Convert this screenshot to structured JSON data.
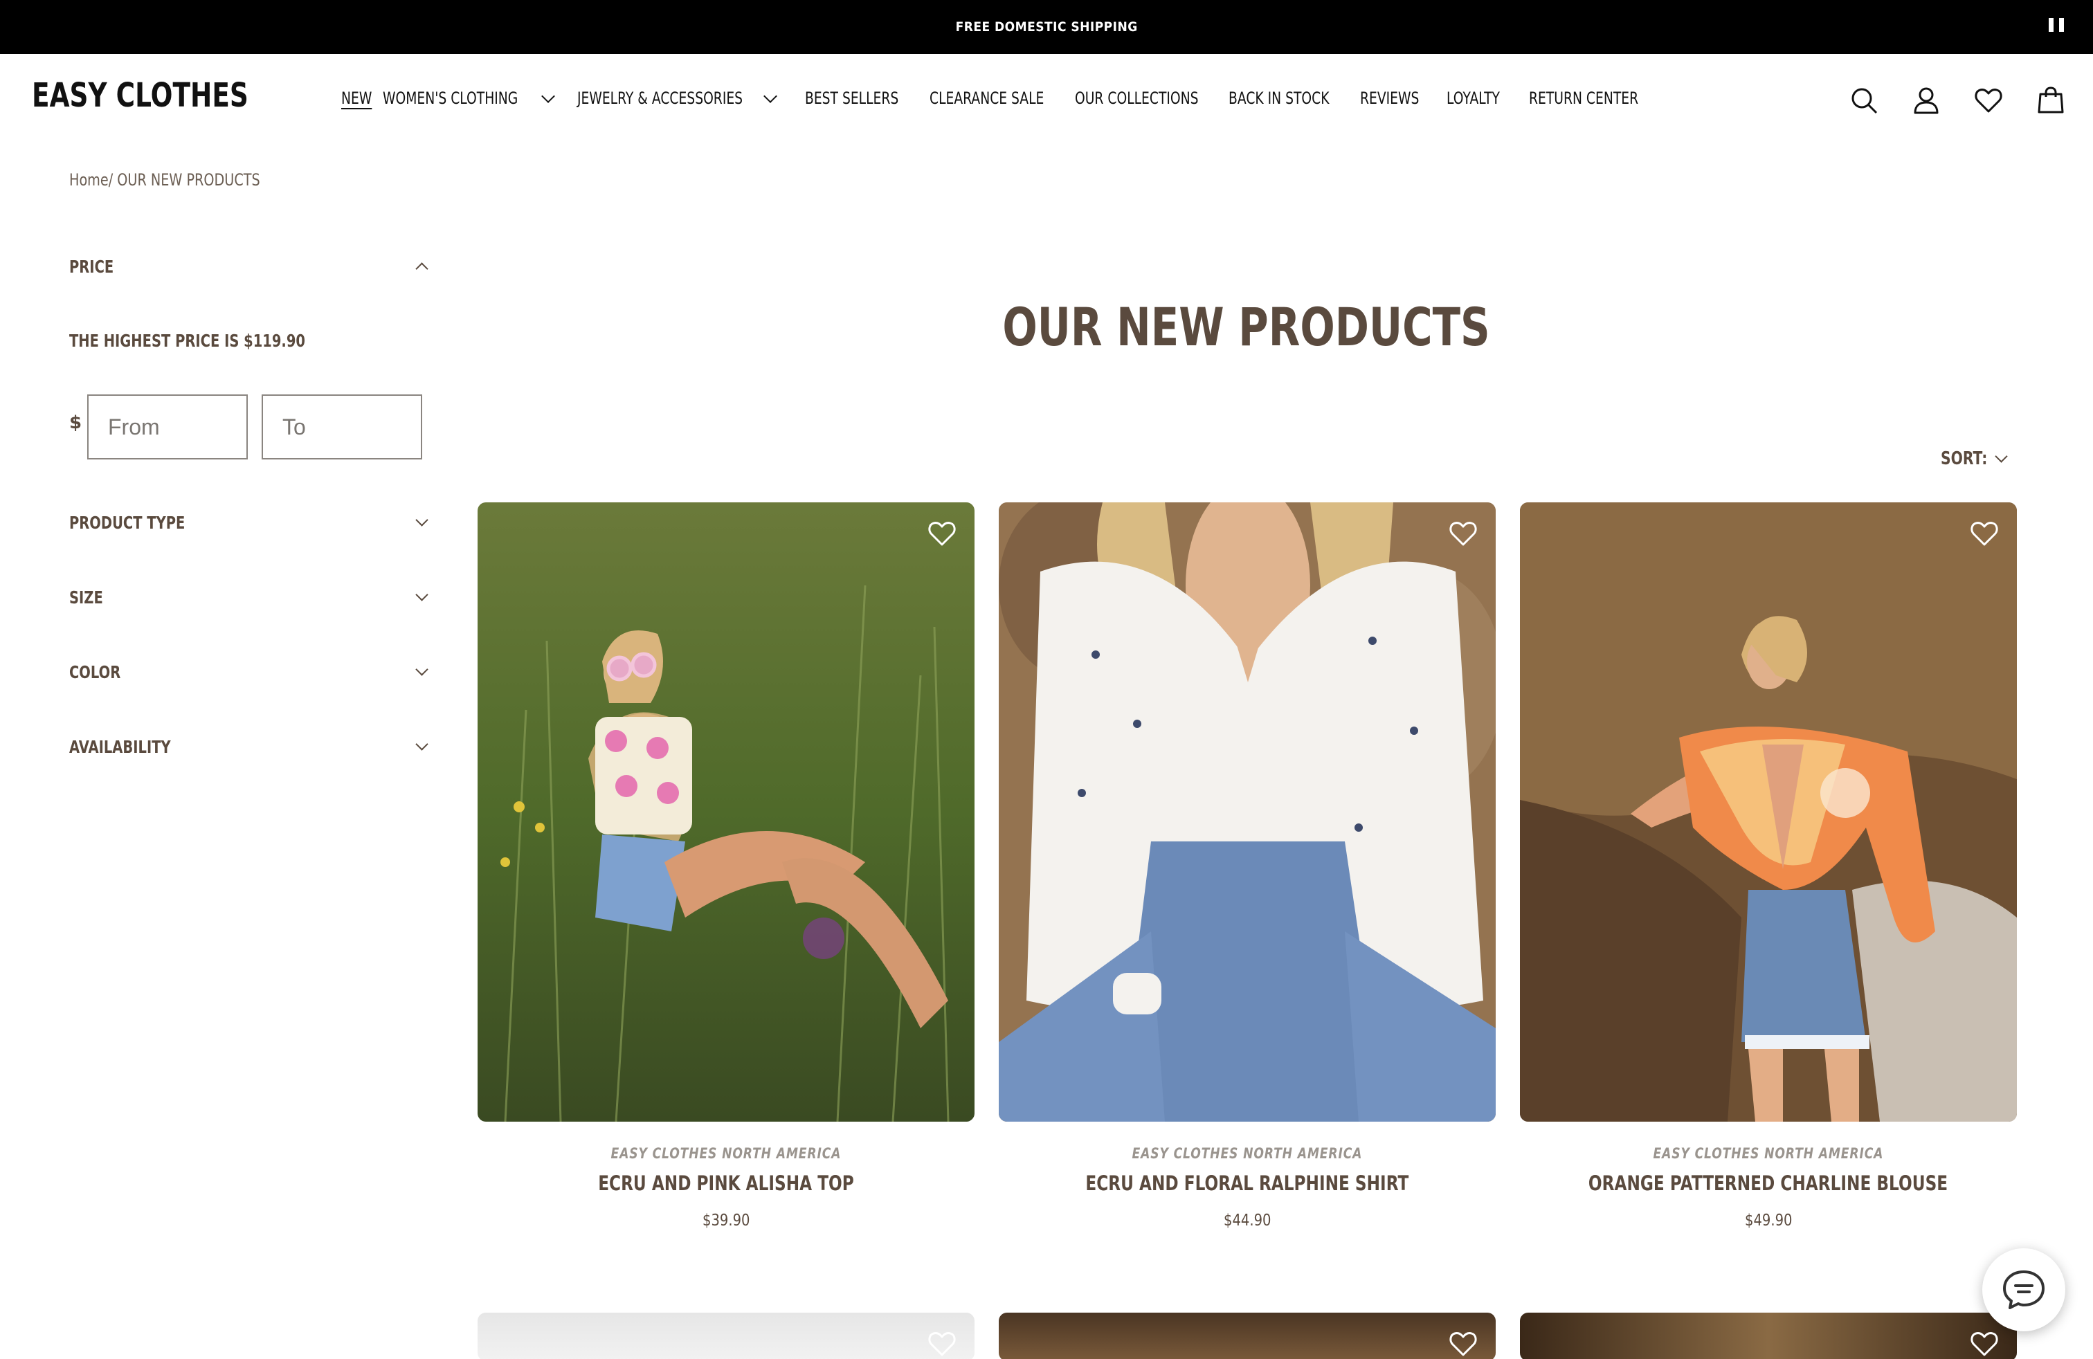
{
  "announcement": {
    "text": "FREE DOMESTIC SHIPPING",
    "pause_icon": "pause-icon"
  },
  "header": {
    "logo": "EASY CLOTHES",
    "nav": [
      {
        "label": "NEW",
        "active": true,
        "dropdown": false
      },
      {
        "label": "WOMEN'S CLOTHING",
        "active": false,
        "dropdown": true
      },
      {
        "label": "JEWELRY & ACCESSORIES",
        "active": false,
        "dropdown": true
      },
      {
        "label": "BEST SELLERS",
        "active": false,
        "dropdown": false
      },
      {
        "label": "CLEARANCE SALE",
        "active": false,
        "dropdown": false
      },
      {
        "label": "OUR COLLECTIONS",
        "active": false,
        "dropdown": false
      },
      {
        "label": "BACK IN STOCK",
        "active": false,
        "dropdown": false
      },
      {
        "label": "REVIEWS",
        "active": false,
        "dropdown": false
      },
      {
        "label": "LOYALTY",
        "active": false,
        "dropdown": false
      },
      {
        "label": "RETURN CENTER",
        "active": false,
        "dropdown": false
      }
    ],
    "icons": [
      "search-icon",
      "account-icon",
      "wishlist-heart-icon",
      "cart-icon"
    ]
  },
  "breadcrumb": {
    "home": "Home",
    "separator": "/",
    "current": "OUR NEW PRODUCTS"
  },
  "filters": {
    "price": {
      "title": "PRICE",
      "expanded": true,
      "highest_text": "THE HIGHEST PRICE IS $119.90",
      "currency": "$",
      "from_placeholder": "From",
      "to_placeholder": "To"
    },
    "groups": [
      {
        "title": "PRODUCT TYPE"
      },
      {
        "title": "SIZE"
      },
      {
        "title": "COLOR"
      },
      {
        "title": "AVAILABILITY"
      }
    ]
  },
  "main": {
    "title": "OUR NEW PRODUCTS",
    "sort_label": "SORT:",
    "products": [
      {
        "brand": "EASY CLOTHES NORTH AMERICA",
        "name": "ECRU AND PINK ALISHA TOP",
        "price": "$39.90"
      },
      {
        "brand": "EASY CLOTHES NORTH AMERICA",
        "name": "ECRU AND FLORAL RALPHINE SHIRT",
        "price": "$44.90"
      },
      {
        "brand": "EASY CLOTHES NORTH AMERICA",
        "name": "ORANGE PATTERNED CHARLINE BLOUSE",
        "price": "$49.90"
      }
    ]
  },
  "colors": {
    "text_brown": "#5a4a3e",
    "breadcrumb_brown": "#6b5e53",
    "brand_gray": "#9a948e",
    "announcement_bg": "#000000"
  },
  "chat": {
    "icon": "chat-bubble-icon"
  }
}
